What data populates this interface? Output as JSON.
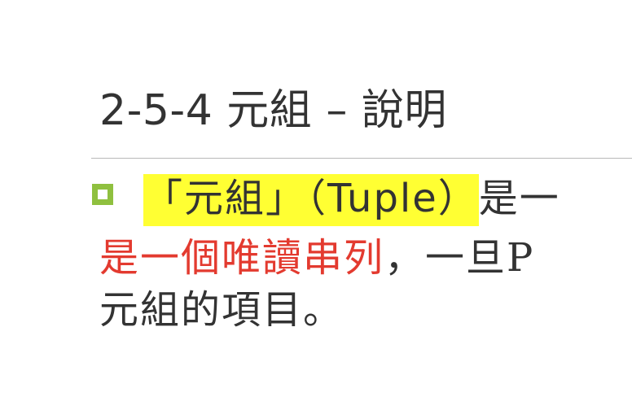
{
  "slide": {
    "title": "2-5-4 元組 – 說明",
    "line1": {
      "highlight": "「元組」（Tuple）",
      "rest": "是一"
    },
    "line2": {
      "red": "是一個唯讀串列",
      "rest": "，一旦P"
    },
    "line3": "元組的項目。"
  },
  "colors": {
    "bullet": "#8fc03f",
    "highlight": "#ffff33",
    "emphasis": "#e33a2f",
    "text": "#333333",
    "divider": "#b9b9b9"
  },
  "icons": {
    "bullet": "square-bullet-icon"
  }
}
